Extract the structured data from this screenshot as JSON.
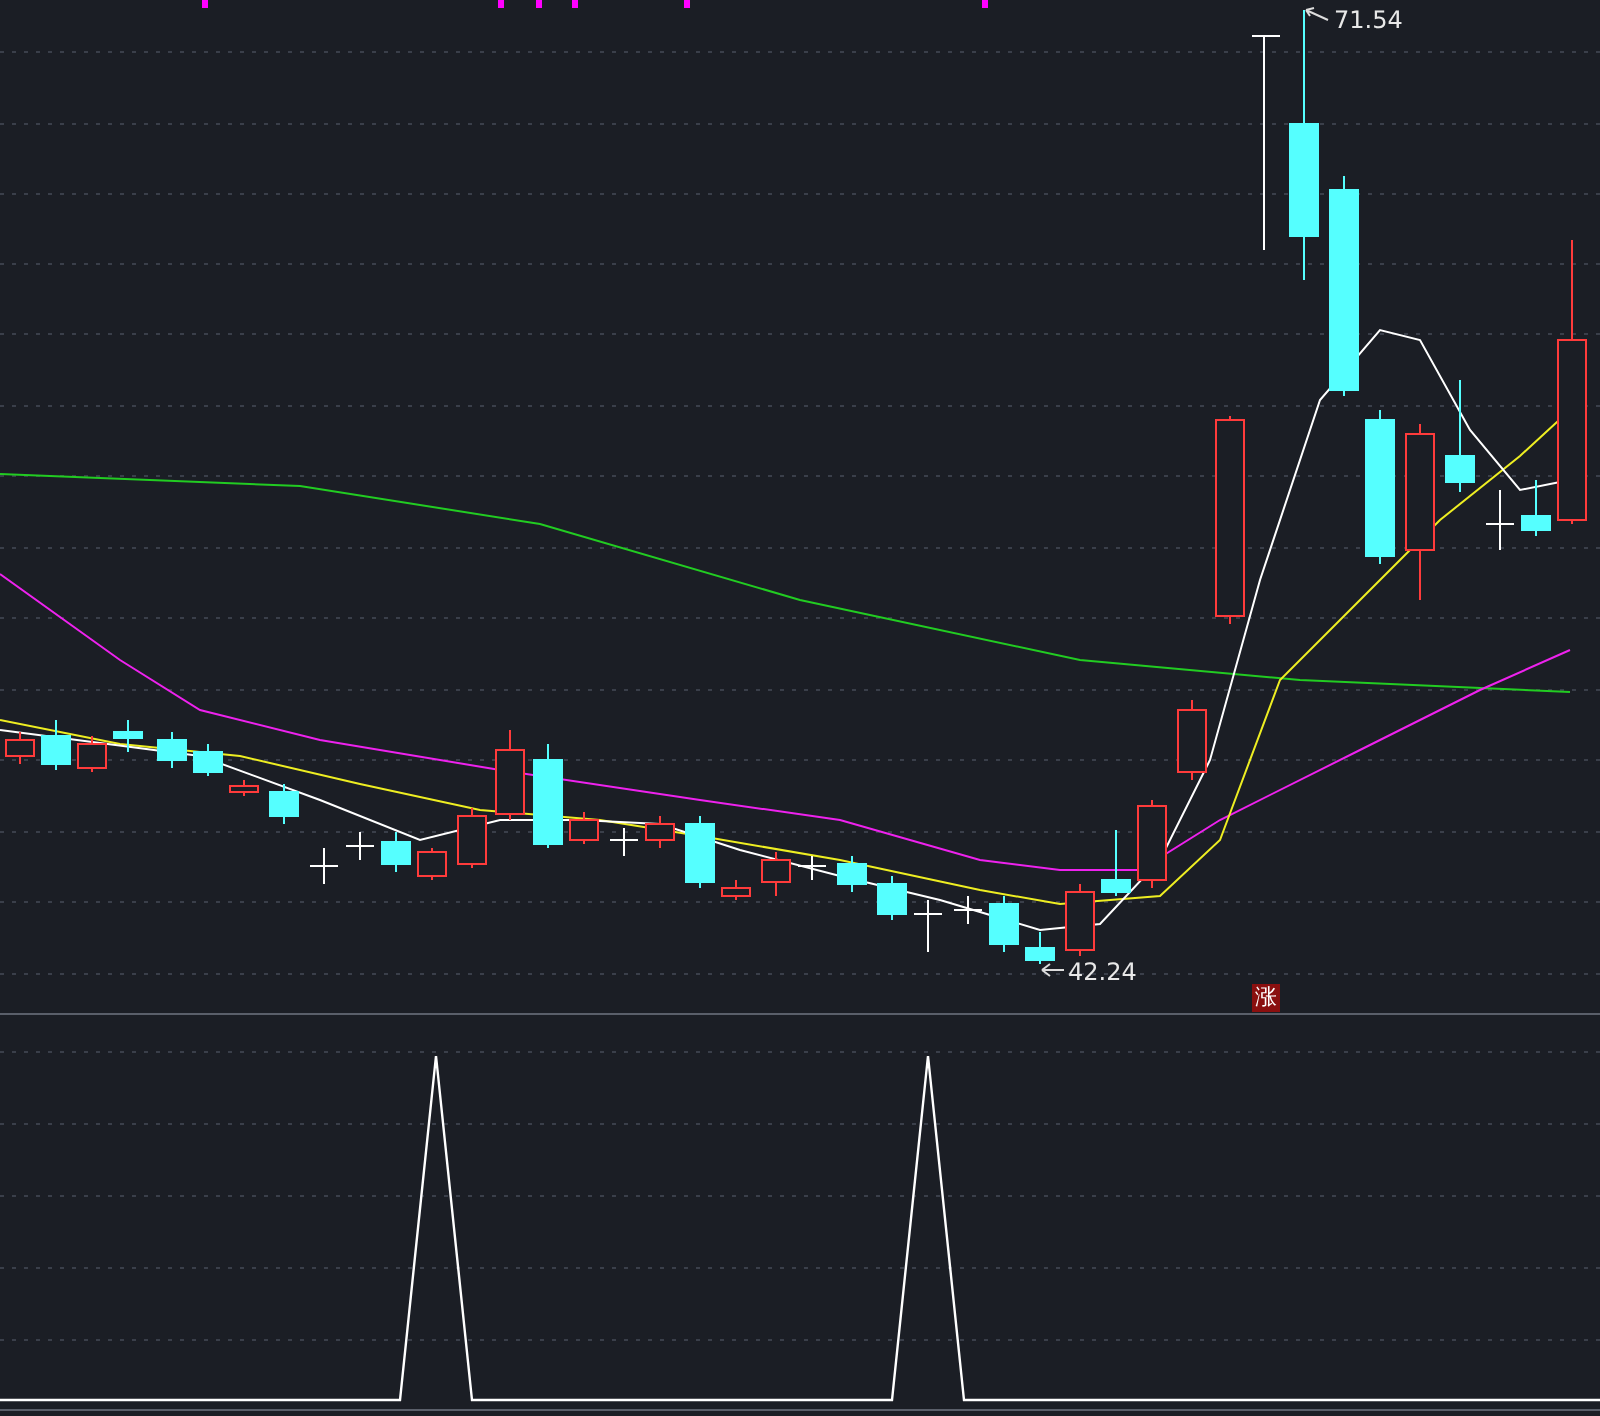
{
  "high_price_label": "71.54",
  "low_price_label": "42.24",
  "rise_badge": "涨"
}
